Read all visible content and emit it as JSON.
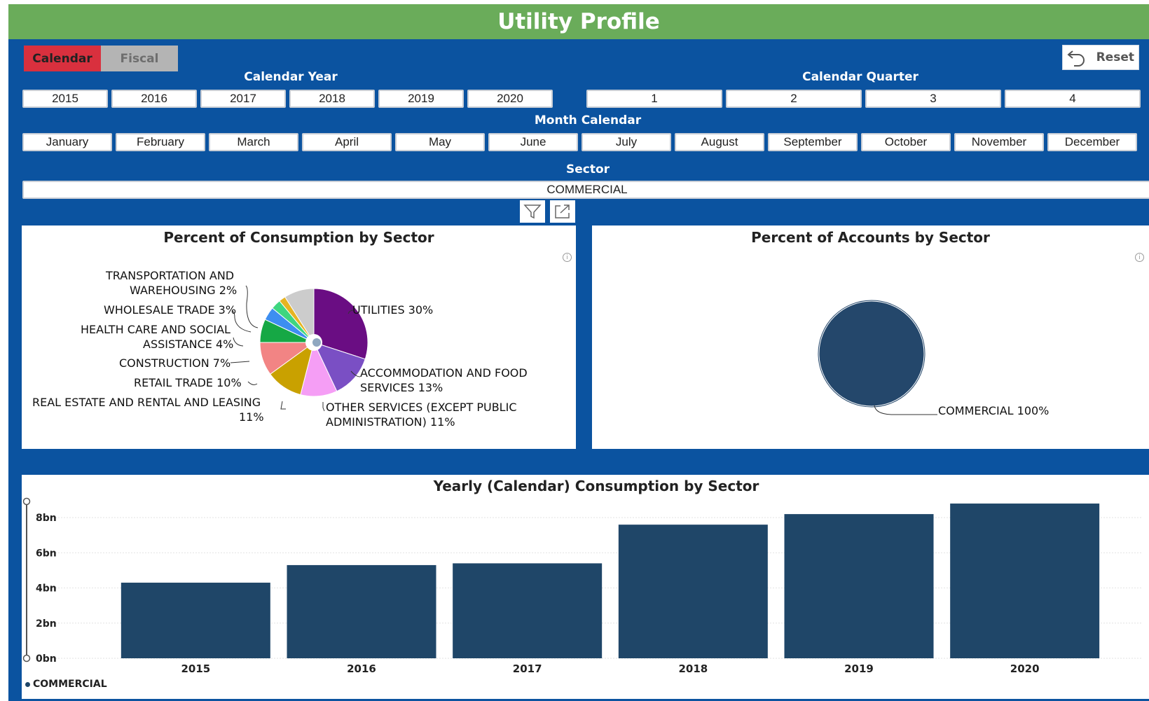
{
  "header": {
    "title": "Utility Profile"
  },
  "toggle": {
    "calendar": "Calendar",
    "fiscal": "Fiscal"
  },
  "reset": {
    "label": "Reset"
  },
  "calendar_year": {
    "title": "Calendar Year",
    "options": [
      "2015",
      "2016",
      "2017",
      "2018",
      "2019",
      "2020"
    ]
  },
  "calendar_quarter": {
    "title": "Calendar Quarter",
    "options": [
      "1",
      "2",
      "3",
      "4"
    ]
  },
  "month_calendar": {
    "title": "Month Calendar",
    "options": [
      "January",
      "February",
      "March",
      "April",
      "May",
      "June",
      "July",
      "August",
      "September",
      "October",
      "November",
      "December"
    ]
  },
  "sector": {
    "title": "Sector",
    "value": "COMMERCIAL"
  },
  "icons": {
    "filter": "filter-icon",
    "focus": "focus-mode-icon",
    "reset": "undo-icon",
    "info": "info-icon"
  },
  "colors": {
    "banner": "#6aac5a",
    "background": "#0b53a0",
    "calendar_active": "#d9303e",
    "fiscal_inactive": "#b4b4b4",
    "bar": "#1f4668"
  },
  "consumption_pie": {
    "title": "Percent of Consumption by Sector",
    "labels": {
      "utilities": "UTILITIES 30%",
      "accommodation_1": "ACCOMMODATION AND FOOD",
      "accommodation_2": "SERVICES 13%",
      "other_1": "OTHER SERVICES (EXCEPT PUBLIC",
      "other_2": "ADMINISTRATION) 11%",
      "real_estate_1": "REAL ESTATE AND RENTAL AND LEASING",
      "real_estate_2": "11%",
      "retail": "RETAIL TRADE 10%",
      "construction": "CONSTRUCTION 7%",
      "health_1": "HEALTH CARE AND SOCIAL",
      "health_2": "ASSISTANCE 4%",
      "wholesale": "WHOLESALE TRADE 3%",
      "transport_1": "TRANSPORTATION AND",
      "transport_2": "WAREHOUSING 2%"
    }
  },
  "accounts_pie": {
    "title": "Percent of Accounts by Sector",
    "label": "COMMERCIAL 100%"
  },
  "bar_chart": {
    "title": "Yearly (Calendar) Consumption by Sector",
    "legend": "COMMERCIAL"
  },
  "chart_data": [
    {
      "type": "pie",
      "title": "Percent of Consumption by Sector",
      "slices": [
        {
          "label": "UTILITIES",
          "value": 30,
          "color": "#6a0d83"
        },
        {
          "label": "ACCOMMODATION AND FOOD SERVICES",
          "value": 13,
          "color": "#7a4fc4"
        },
        {
          "label": "OTHER SERVICES (EXCEPT PUBLIC ADMINISTRATION)",
          "value": 11,
          "color": "#f59ef5"
        },
        {
          "label": "REAL ESTATE AND RENTAL AND LEASING",
          "value": 11,
          "color": "#c9a100"
        },
        {
          "label": "RETAIL TRADE",
          "value": 10,
          "color": "#f28484"
        },
        {
          "label": "CONSTRUCTION",
          "value": 7,
          "color": "#16a845"
        },
        {
          "label": "HEALTH CARE AND SOCIAL ASSISTANCE",
          "value": 4,
          "color": "#3d8ef0"
        },
        {
          "label": "WHOLESALE TRADE",
          "value": 3,
          "color": "#3ed680"
        },
        {
          "label": "TRANSPORTATION AND WAREHOUSING",
          "value": 2,
          "color": "#e6b422"
        },
        {
          "label": "",
          "value": 9,
          "color": "#cccccc"
        }
      ]
    },
    {
      "type": "pie",
      "title": "Percent of Accounts by Sector",
      "slices": [
        {
          "label": "COMMERCIAL",
          "value": 100,
          "color": "#24476b"
        }
      ]
    },
    {
      "type": "bar",
      "title": "Yearly (Calendar) Consumption by Sector",
      "categories": [
        "2015",
        "2016",
        "2017",
        "2018",
        "2019",
        "2020"
      ],
      "series": [
        {
          "name": "COMMERCIAL",
          "values": [
            4.3,
            5.3,
            5.4,
            7.6,
            8.2,
            8.8
          ]
        }
      ],
      "yticks": [
        "0bn",
        "2bn",
        "4bn",
        "6bn",
        "8bn"
      ],
      "ylim": [
        0,
        9.2
      ]
    }
  ]
}
